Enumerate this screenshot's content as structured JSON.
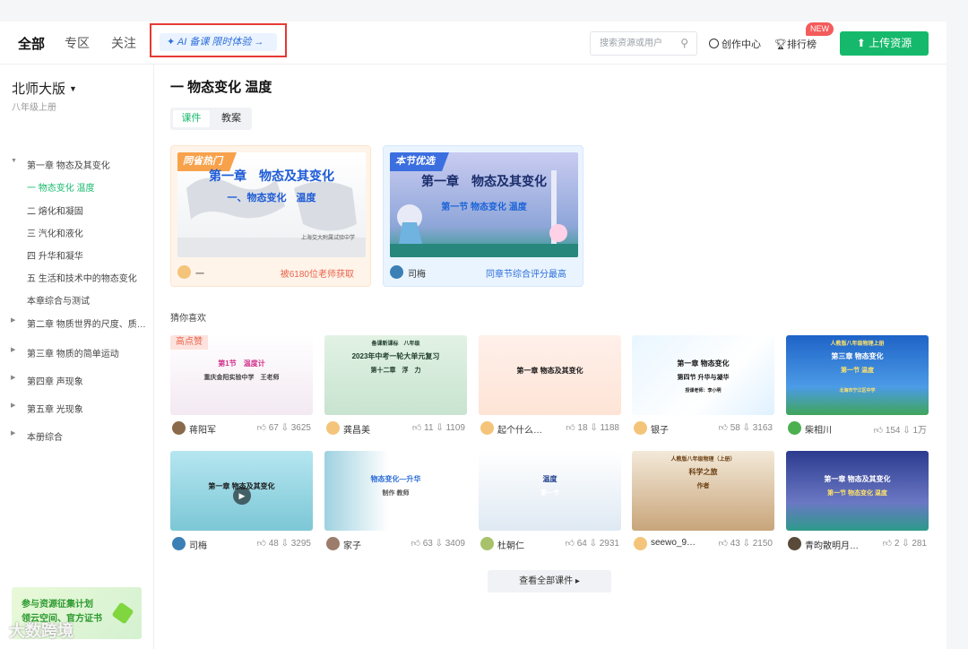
{
  "header": {
    "tabs": [
      "全部",
      "专区",
      "关注"
    ],
    "ai_banner": "✦ AI 备课 限时体验 →",
    "search_placeholder": "搜索资源或用户",
    "creator_center": "创作中心",
    "ranking": "排行榜",
    "new_badge": "NEW",
    "upload": "上传资源"
  },
  "sidebar": {
    "publisher": "北师大版",
    "grade": "八年级上册",
    "items": [
      {
        "label": "第一章 物态及其变化",
        "arrow": "▼",
        "indent": false
      },
      {
        "label": "一 物态变化 温度",
        "arrow": "",
        "indent": true,
        "active": true
      },
      {
        "label": "二 熔化和凝固",
        "arrow": "",
        "indent": true
      },
      {
        "label": "三 汽化和液化",
        "arrow": "",
        "indent": true
      },
      {
        "label": "四 升华和凝华",
        "arrow": "",
        "indent": true
      },
      {
        "label": "五 生活和技术中的物态变化",
        "arrow": "",
        "indent": true
      },
      {
        "label": "本章综合与测试",
        "arrow": "",
        "indent": true
      },
      {
        "label": "第二章 物质世界的尺度、质…",
        "arrow": "▶",
        "indent": false
      },
      {
        "label": "第三章 物质的简单运动",
        "arrow": "▶",
        "indent": false
      },
      {
        "label": "第四章 声现象",
        "arrow": "▶",
        "indent": false
      },
      {
        "label": "第五章 光现象",
        "arrow": "▶",
        "indent": false
      },
      {
        "label": "本册综合",
        "arrow": "▶",
        "indent": false
      }
    ],
    "promo_line1": "参与资源征集计划",
    "promo_line2": "领云空间、官方证书"
  },
  "main": {
    "title": "一 物态变化 温度",
    "subtabs": [
      "课件",
      "教案"
    ],
    "featured": [
      {
        "tag": "同省热门",
        "title": "第一章　物态及其变化",
        "subtitle": "一、物态变化　温度",
        "school": "上海交大附属试验中学",
        "author": "一",
        "note": "被6180位老师获取"
      },
      {
        "tag": "本节优选",
        "title": "第一章　物态及其变化",
        "subtitle": "第一节 物态变化 温度",
        "author": "司梅",
        "note": "同章节综合评分最高"
      }
    ],
    "section_label": "猜你喜欢",
    "cards": [
      {
        "author": "蒋阳军",
        "likes": "67",
        "downloads": "3625",
        "hot": "高点赞",
        "t1": "第1节　温度计",
        "t2": "重庆金阳实验中学　王老师"
      },
      {
        "author": "龚昌美",
        "likes": "11",
        "downloads": "1109",
        "t0": "备课新课标　八年级",
        "t1": "2023年中考一轮大单元复习",
        "t2": "第十二章　浮　力"
      },
      {
        "author": "起个什么…",
        "likes": "18",
        "downloads": "1188",
        "t1": "第一章 物态及其变化"
      },
      {
        "author": "银子",
        "likes": "58",
        "downloads": "3163",
        "t1": "第一章 物态变化",
        "t2": "第四节 升华与凝华",
        "t3": "授课老师：李小明"
      },
      {
        "author": "柴相川",
        "likes": "154",
        "downloads": "1万",
        "t0": "人教版八年级物理上册",
        "t1": "第三章 物态变化",
        "t2": "第一节 温度",
        "t3": "北海市宁江区中学"
      },
      {
        "author": "司梅",
        "likes": "48",
        "downloads": "3295",
        "t1": "第一章 物态及其变化"
      },
      {
        "author": "家子",
        "likes": "63",
        "downloads": "3409",
        "t1": "物态变化—升华",
        "t2": "制作 教师"
      },
      {
        "author": "杜朝仁",
        "likes": "64",
        "downloads": "2931",
        "t1": "温度",
        "t2": "第一节"
      },
      {
        "author": "seewo_9…",
        "likes": "43",
        "downloads": "2150",
        "t0": "人教版八年级物理（上册）",
        "t1": "科学之旅",
        "t2": "作者"
      },
      {
        "author": "青昀散明月…",
        "likes": "2",
        "downloads": "281",
        "t1": "第一章 物态及其变化",
        "t2": "第一节 物态变化 温度"
      }
    ],
    "view_all": "查看全部课件 ▸"
  },
  "watermark": "大数跨境",
  "colors": {
    "accent": "#16b96b",
    "ai_blue": "#2d6fd8",
    "alert": "#e53935",
    "new": "#f45b5b"
  }
}
